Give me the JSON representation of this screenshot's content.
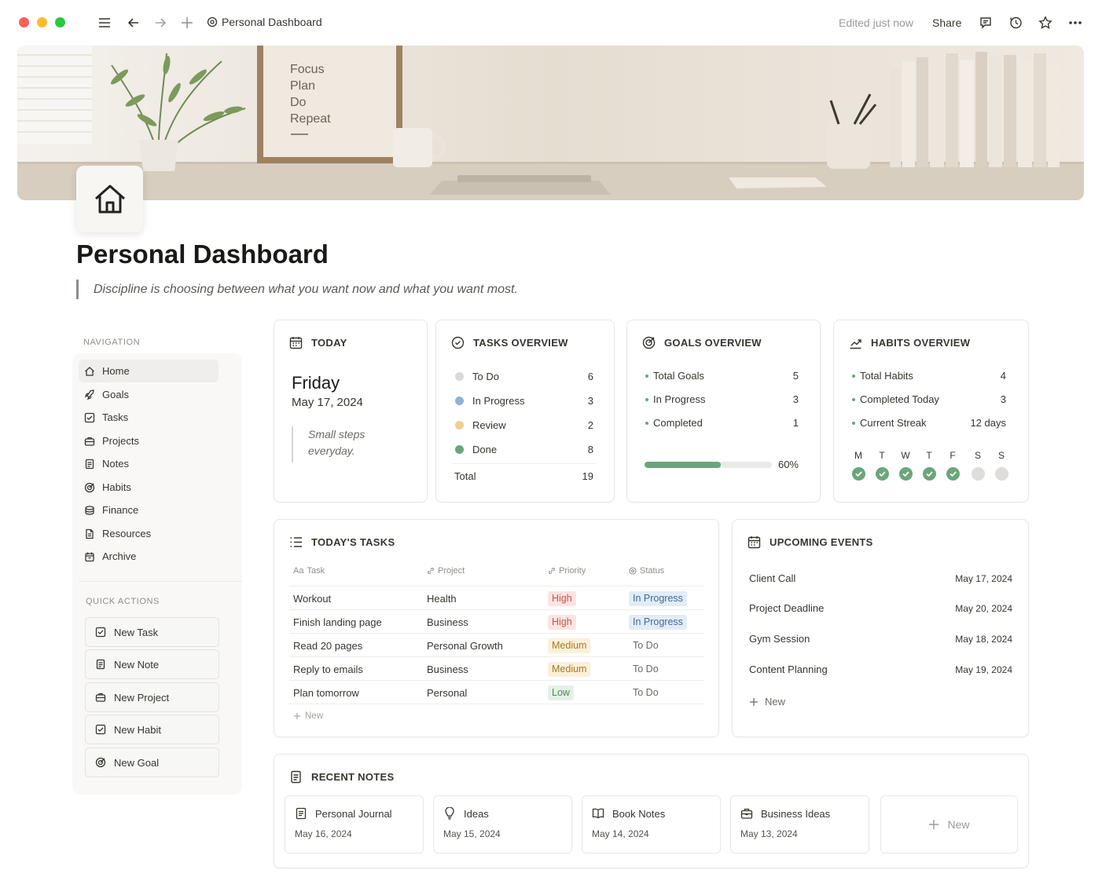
{
  "titlebar": {
    "breadcrumb": "Personal Dashboard",
    "edited": "Edited just now",
    "share": "Share"
  },
  "cover": {
    "poster_lines": [
      "Focus",
      "Plan",
      "Do",
      "Repeat"
    ]
  },
  "page": {
    "title": "Personal Dashboard",
    "quote": "Discipline is choosing between what you want now and what you want most."
  },
  "sidebar": {
    "nav_label": "NAVIGATION",
    "items": [
      {
        "label": "Home",
        "icon": "home-icon"
      },
      {
        "label": "Goals",
        "icon": "rocket-icon"
      },
      {
        "label": "Tasks",
        "icon": "checkbox-icon"
      },
      {
        "label": "Projects",
        "icon": "briefcase-icon"
      },
      {
        "label": "Notes",
        "icon": "note-icon"
      },
      {
        "label": "Habits",
        "icon": "target-icon"
      },
      {
        "label": "Finance",
        "icon": "coins-icon"
      },
      {
        "label": "Resources",
        "icon": "document-icon"
      },
      {
        "label": "Archive",
        "icon": "archive-icon"
      }
    ],
    "quick_label": "QUICK ACTIONS",
    "quick_actions": [
      {
        "label": "New Task"
      },
      {
        "label": "New Note"
      },
      {
        "label": "New Project"
      },
      {
        "label": "New Habit"
      },
      {
        "label": "New Goal"
      }
    ]
  },
  "today": {
    "heading": "TODAY",
    "day": "Friday",
    "date": "May 17, 2024",
    "quote_line1": "Small steps",
    "quote_line2": "everyday."
  },
  "tasks_overview": {
    "heading": "TASKS OVERVIEW",
    "rows": [
      {
        "label": "To Do",
        "value": "6",
        "color": "#d9d9d7"
      },
      {
        "label": "In Progress",
        "value": "3",
        "color": "#8fb3d9"
      },
      {
        "label": "Review",
        "value": "2",
        "color": "#f0cf8e"
      },
      {
        "label": "Done",
        "value": "8",
        "color": "#6aa67a"
      }
    ],
    "total_label": "Total",
    "total_value": "19"
  },
  "goals_overview": {
    "heading": "GOALS OVERVIEW",
    "rows": [
      {
        "label": "Total Goals",
        "value": "5"
      },
      {
        "label": "In Progress",
        "value": "3"
      },
      {
        "label": "Completed",
        "value": "1"
      }
    ],
    "progress_percent": 60,
    "progress_label": "60%"
  },
  "habits_overview": {
    "heading": "HABITS OVERVIEW",
    "rows": [
      {
        "label": "Total Habits",
        "value": "4"
      },
      {
        "label": "Completed Today",
        "value": "3"
      },
      {
        "label": "Current Streak",
        "value": "12 days"
      }
    ],
    "days": [
      {
        "label": "M",
        "done": true
      },
      {
        "label": "T",
        "done": true
      },
      {
        "label": "W",
        "done": true
      },
      {
        "label": "T",
        "done": true
      },
      {
        "label": "F",
        "done": true
      },
      {
        "label": "S",
        "done": false
      },
      {
        "label": "S",
        "done": false
      }
    ]
  },
  "todays_tasks": {
    "heading": "TODAY'S TASKS",
    "columns": {
      "task": "Task",
      "project": "Project",
      "priority": "Priority",
      "status": "Status",
      "task_prefix": "Aa"
    },
    "rows": [
      {
        "task": "Workout",
        "project": "Health",
        "priority": "High",
        "status": "In Progress"
      },
      {
        "task": "Finish landing page",
        "project": "Business",
        "priority": "High",
        "status": "In Progress"
      },
      {
        "task": "Read 20 pages",
        "project": "Personal Growth",
        "priority": "Medium",
        "status": "To Do"
      },
      {
        "task": "Reply to emails",
        "project": "Business",
        "priority": "Medium",
        "status": "To Do"
      },
      {
        "task": "Plan tomorrow",
        "project": "Personal",
        "priority": "Low",
        "status": "To Do"
      }
    ],
    "new_label": "New"
  },
  "upcoming_events": {
    "heading": "UPCOMING EVENTS",
    "events": [
      {
        "name": "Client Call",
        "date": "May 17, 2024"
      },
      {
        "name": "Project Deadline",
        "date": "May 20, 2024"
      },
      {
        "name": "Gym Session",
        "date": "May 18, 2024"
      },
      {
        "name": "Content Planning",
        "date": "May 19, 2024"
      }
    ],
    "new_label": "New"
  },
  "recent_notes": {
    "heading": "RECENT NOTES",
    "notes": [
      {
        "title": "Personal Journal",
        "date": "May 16, 2024",
        "icon": "note-icon"
      },
      {
        "title": "Ideas",
        "date": "May 15, 2024",
        "icon": "lightbulb-icon"
      },
      {
        "title": "Book Notes",
        "date": "May 14, 2024",
        "icon": "book-icon"
      },
      {
        "title": "Business Ideas",
        "date": "May 13, 2024",
        "icon": "briefcase-icon"
      }
    ],
    "new_label": "New"
  },
  "colors": {
    "accent_green": "#6aa67a",
    "high_bg": "#fbe4e1",
    "high_fg": "#c4554d",
    "medium_bg": "#fbf0d9",
    "medium_fg": "#a77a26",
    "low_bg": "#e4f1e6",
    "low_fg": "#4d8a5c",
    "in_progress_bg": "#e2ecf6",
    "in_progress_fg": "#3f6a99"
  }
}
